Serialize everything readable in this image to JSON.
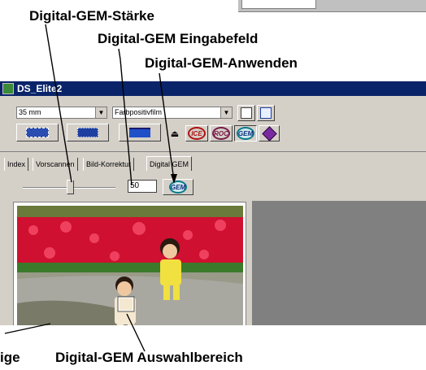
{
  "callouts": {
    "strength": "Digital-GEM-Stärke",
    "input_field": "Digital-GEM Eingabefeld",
    "apply": "Digital-GEM-Anwenden",
    "left_cut": "ige",
    "selection": "Digital-GEM Auswahlbereich"
  },
  "window": {
    "title": "DS_Elite2",
    "film_format": "35 mm",
    "film_type": "Farbpositivfilm"
  },
  "tabs": [
    {
      "label": "Index"
    },
    {
      "label": "Vorscannen"
    },
    {
      "label": "Bild-Korrektur"
    },
    {
      "label": "Digital GEM"
    }
  ],
  "gem": {
    "value": "50"
  },
  "toolbar": {
    "ice_label": "ICE",
    "roc_label": "ROC",
    "gem_label": "GEM"
  }
}
